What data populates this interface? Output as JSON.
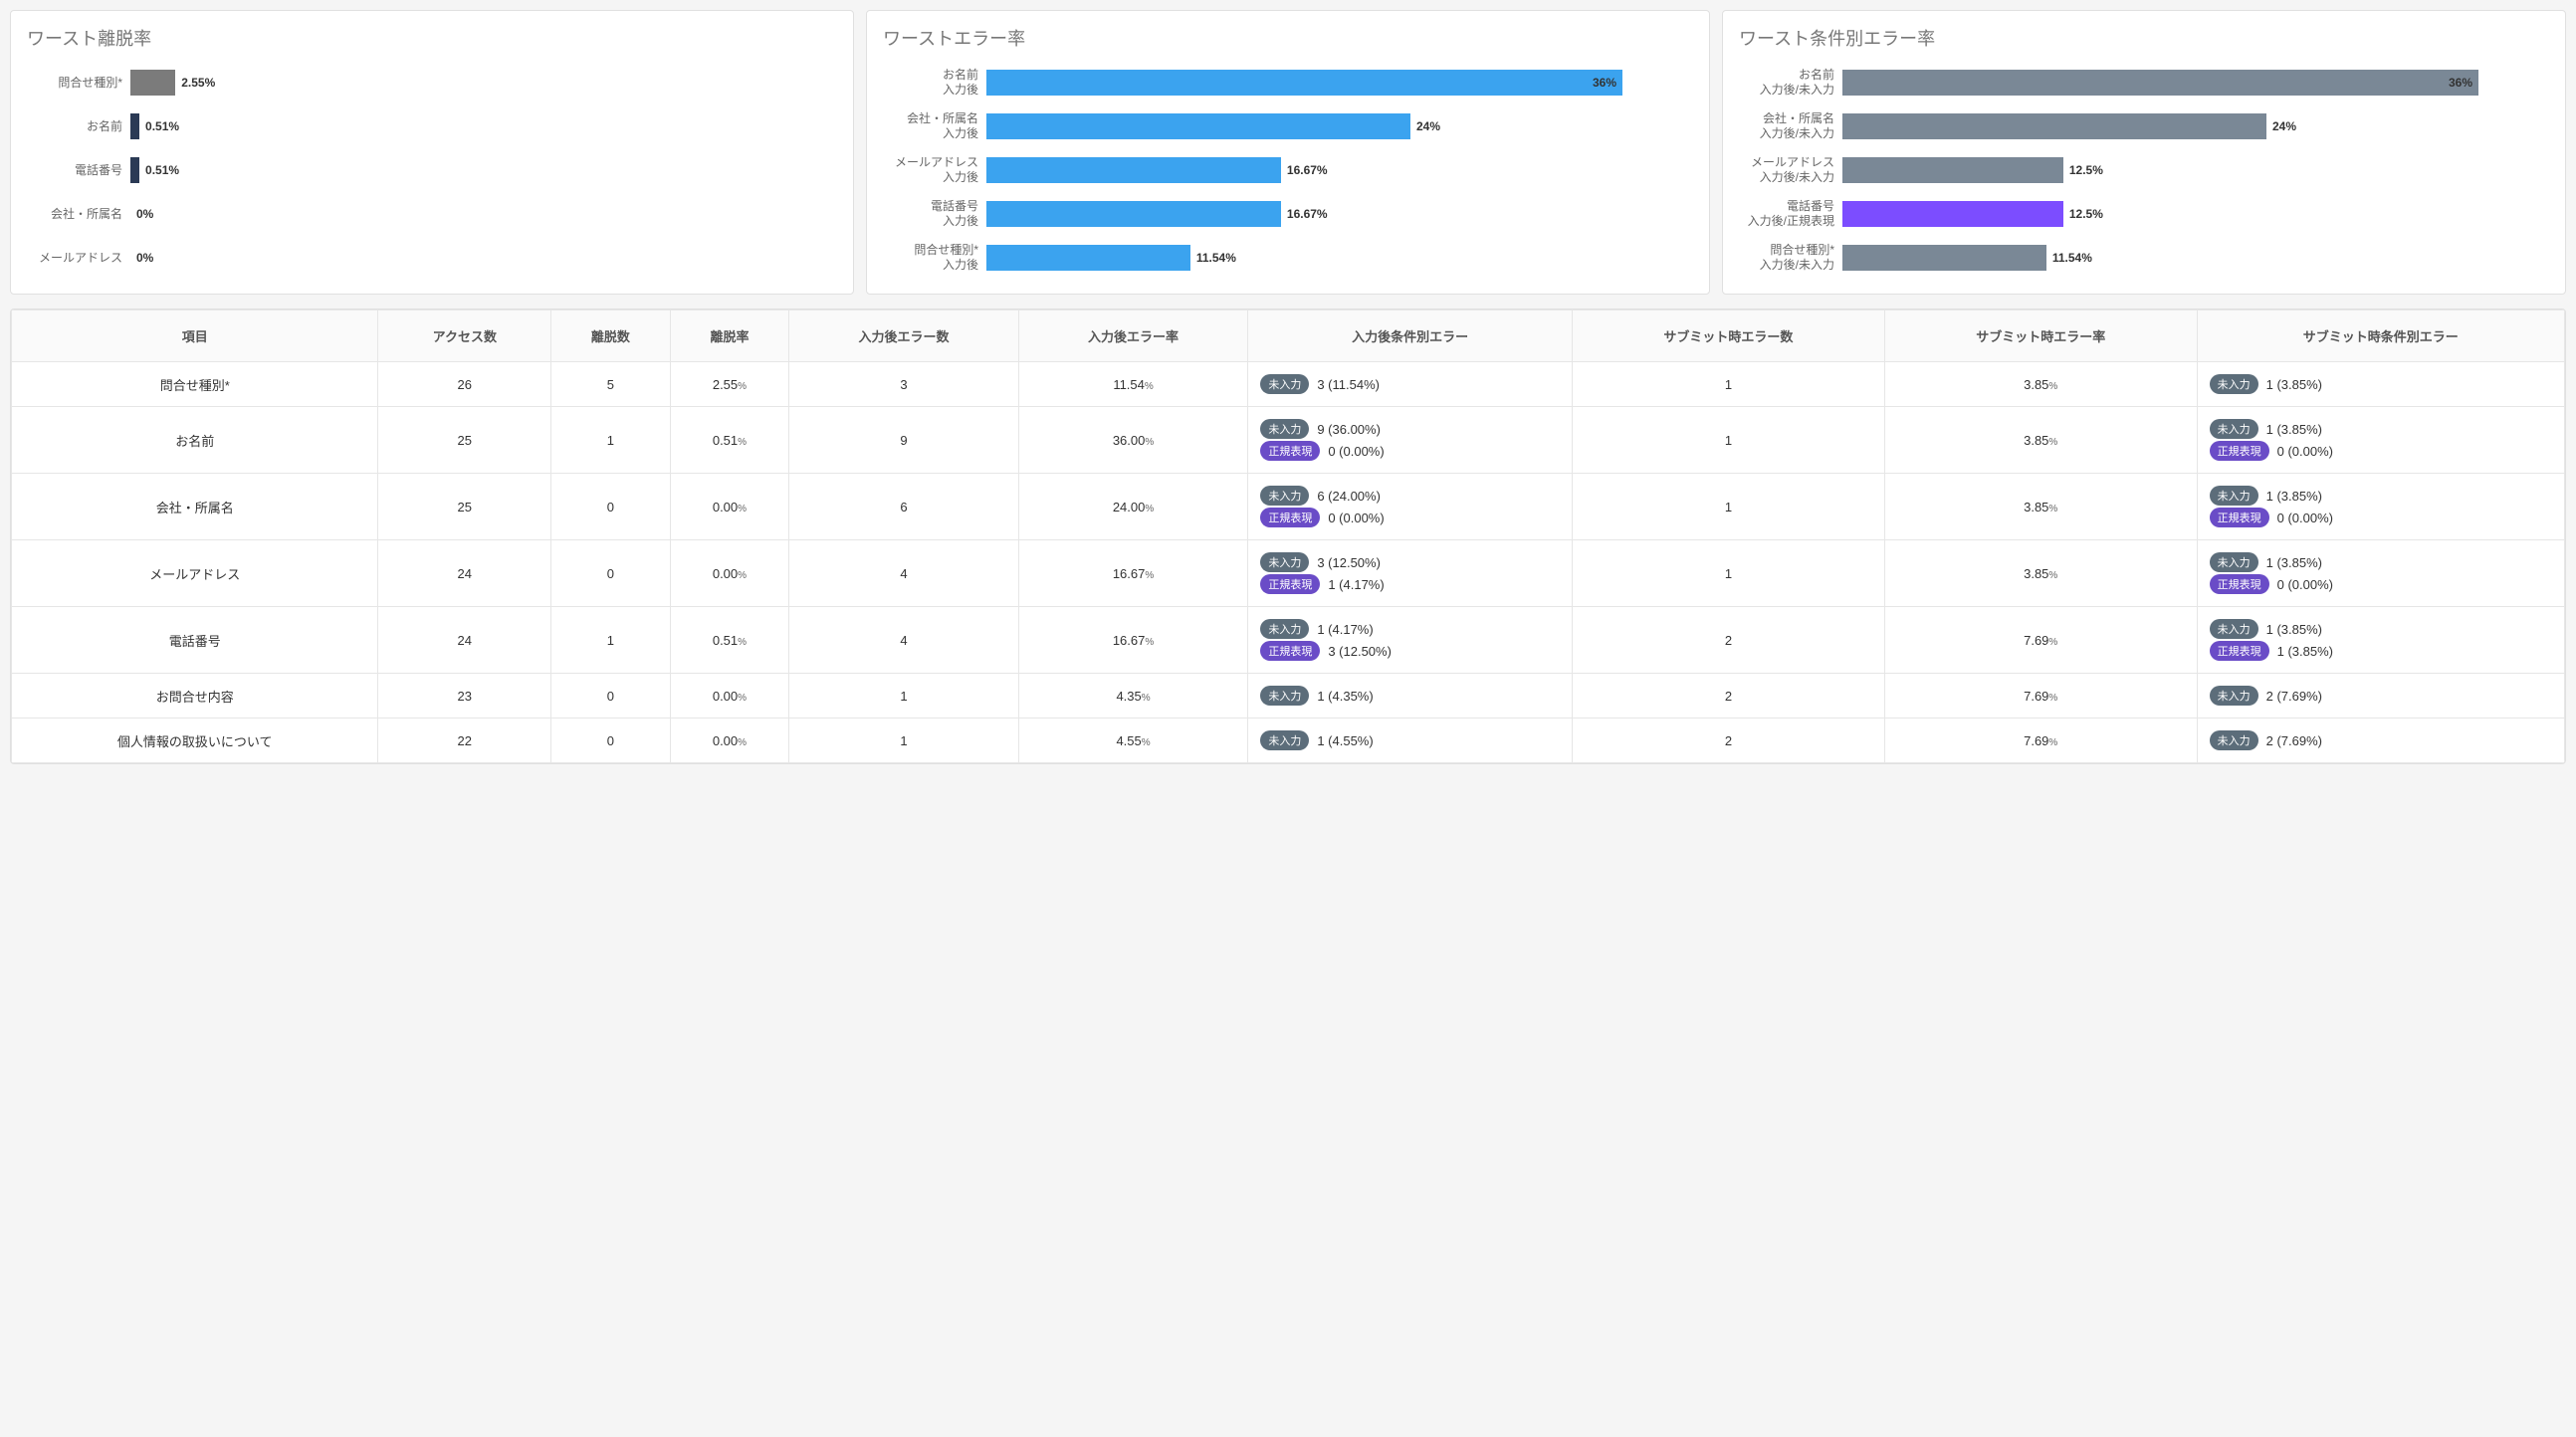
{
  "badge_labels": {
    "miinput": "未入力",
    "regex": "正規表現"
  },
  "chart_data": [
    {
      "type": "bar",
      "title": "ワースト離脱率",
      "max_pct": 40,
      "bars": [
        {
          "label": "問合せ種別*",
          "value": 2.55,
          "display": "2.55%",
          "color": "grey"
        },
        {
          "label": "お名前",
          "value": 0.51,
          "display": "0.51%",
          "color": "navy"
        },
        {
          "label": "電話番号",
          "value": 0.51,
          "display": "0.51%",
          "color": "navy"
        },
        {
          "label": "会社・所属名",
          "value": 0,
          "display": "0%",
          "color": "grey"
        },
        {
          "label": "メールアドレス",
          "value": 0,
          "display": "0%",
          "color": "grey"
        }
      ]
    },
    {
      "type": "bar",
      "title": "ワーストエラー率",
      "max_pct": 40,
      "bars": [
        {
          "label": "お名前\n入力後",
          "value": 36,
          "display": "36%",
          "color": "blue",
          "inside": true
        },
        {
          "label": "会社・所属名\n入力後",
          "value": 24,
          "display": "24%",
          "color": "blue"
        },
        {
          "label": "メールアドレス\n入力後",
          "value": 16.67,
          "display": "16.67%",
          "color": "blue"
        },
        {
          "label": "電話番号\n入力後",
          "value": 16.67,
          "display": "16.67%",
          "color": "blue"
        },
        {
          "label": "問合せ種別*\n入力後",
          "value": 11.54,
          "display": "11.54%",
          "color": "blue"
        }
      ]
    },
    {
      "type": "bar",
      "title": "ワースト条件別エラー率",
      "max_pct": 40,
      "bars": [
        {
          "label": "お名前\n入力後/未入力",
          "value": 36,
          "display": "36%",
          "color": "slate",
          "inside": true
        },
        {
          "label": "会社・所属名\n入力後/未入力",
          "value": 24,
          "display": "24%",
          "color": "slate"
        },
        {
          "label": "メールアドレス\n入力後/未入力",
          "value": 12.5,
          "display": "12.5%",
          "color": "slate"
        },
        {
          "label": "電話番号\n入力後/正規表現",
          "value": 12.5,
          "display": "12.5%",
          "color": "purple"
        },
        {
          "label": "問合せ種別*\n入力後/未入力",
          "value": 11.54,
          "display": "11.54%",
          "color": "slate"
        }
      ]
    }
  ],
  "table": {
    "headers": [
      "項目",
      "アクセス数",
      "離脱数",
      "離脱率",
      "入力後エラー数",
      "入力後エラー率",
      "入力後条件別エラー",
      "サブミット時エラー数",
      "サブミット時エラー率",
      "サブミット時条件別エラー"
    ],
    "rows": [
      {
        "item": "問合せ種別*",
        "access": 26,
        "leave": 5,
        "leave_rate": "2.55",
        "after_err": 3,
        "after_err_rate": "11.54",
        "after_cond": [
          {
            "type": "miinput",
            "text": "3 (11.54%)"
          }
        ],
        "submit_err": 1,
        "submit_err_rate": "3.85",
        "submit_cond": [
          {
            "type": "miinput",
            "text": "1 (3.85%)"
          }
        ]
      },
      {
        "item": "お名前",
        "access": 25,
        "leave": 1,
        "leave_rate": "0.51",
        "after_err": 9,
        "after_err_rate": "36.00",
        "after_cond": [
          {
            "type": "miinput",
            "text": "9 (36.00%)"
          },
          {
            "type": "regex",
            "text": "0 (0.00%)"
          }
        ],
        "submit_err": 1,
        "submit_err_rate": "3.85",
        "submit_cond": [
          {
            "type": "miinput",
            "text": "1 (3.85%)"
          },
          {
            "type": "regex",
            "text": "0 (0.00%)"
          }
        ]
      },
      {
        "item": "会社・所属名",
        "access": 25,
        "leave": 0,
        "leave_rate": "0.00",
        "after_err": 6,
        "after_err_rate": "24.00",
        "after_cond": [
          {
            "type": "miinput",
            "text": "6 (24.00%)"
          },
          {
            "type": "regex",
            "text": "0 (0.00%)"
          }
        ],
        "submit_err": 1,
        "submit_err_rate": "3.85",
        "submit_cond": [
          {
            "type": "miinput",
            "text": "1 (3.85%)"
          },
          {
            "type": "regex",
            "text": "0 (0.00%)"
          }
        ]
      },
      {
        "item": "メールアドレス",
        "access": 24,
        "leave": 0,
        "leave_rate": "0.00",
        "after_err": 4,
        "after_err_rate": "16.67",
        "after_cond": [
          {
            "type": "miinput",
            "text": "3 (12.50%)"
          },
          {
            "type": "regex",
            "text": "1 (4.17%)"
          }
        ],
        "submit_err": 1,
        "submit_err_rate": "3.85",
        "submit_cond": [
          {
            "type": "miinput",
            "text": "1 (3.85%)"
          },
          {
            "type": "regex",
            "text": "0 (0.00%)"
          }
        ]
      },
      {
        "item": "電話番号",
        "access": 24,
        "leave": 1,
        "leave_rate": "0.51",
        "after_err": 4,
        "after_err_rate": "16.67",
        "after_cond": [
          {
            "type": "miinput",
            "text": "1 (4.17%)"
          },
          {
            "type": "regex",
            "text": "3 (12.50%)"
          }
        ],
        "submit_err": 2,
        "submit_err_rate": "7.69",
        "submit_cond": [
          {
            "type": "miinput",
            "text": "1 (3.85%)"
          },
          {
            "type": "regex",
            "text": "1 (3.85%)"
          }
        ]
      },
      {
        "item": "お問合せ内容",
        "access": 23,
        "leave": 0,
        "leave_rate": "0.00",
        "after_err": 1,
        "after_err_rate": "4.35",
        "after_cond": [
          {
            "type": "miinput",
            "text": "1 (4.35%)"
          }
        ],
        "submit_err": 2,
        "submit_err_rate": "7.69",
        "submit_cond": [
          {
            "type": "miinput",
            "text": "2 (7.69%)"
          }
        ]
      },
      {
        "item": "個人情報の取扱いについて",
        "access": 22,
        "leave": 0,
        "leave_rate": "0.00",
        "after_err": 1,
        "after_err_rate": "4.55",
        "after_cond": [
          {
            "type": "miinput",
            "text": "1 (4.55%)"
          }
        ],
        "submit_err": 2,
        "submit_err_rate": "7.69",
        "submit_cond": [
          {
            "type": "miinput",
            "text": "2 (7.69%)"
          }
        ]
      }
    ]
  }
}
